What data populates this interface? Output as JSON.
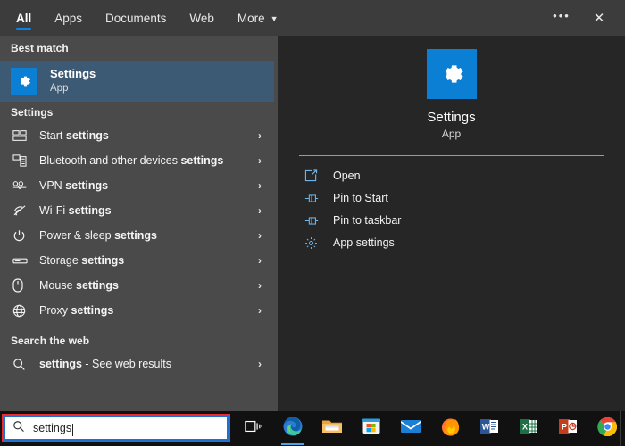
{
  "header": {
    "tabs": [
      {
        "label": "All",
        "active": true
      },
      {
        "label": "Apps",
        "active": false
      },
      {
        "label": "Documents",
        "active": false
      },
      {
        "label": "Web",
        "active": false
      },
      {
        "label": "More",
        "active": false,
        "caret": "▼"
      }
    ],
    "more_options_label": "•••",
    "close_label": "✕"
  },
  "left": {
    "best_match_header": "Best match",
    "best_match": {
      "title": "Settings",
      "subtitle": "App",
      "icon": "gear-icon"
    },
    "settings_header": "Settings",
    "settings_items": [
      {
        "prefix": "Start ",
        "bold": "settings",
        "icon": "start-grid-icon"
      },
      {
        "prefix": "Bluetooth and other devices ",
        "bold": "settings",
        "icon": "bluetooth-devices-icon"
      },
      {
        "prefix": "VPN ",
        "bold": "settings",
        "icon": "vpn-icon"
      },
      {
        "prefix": "Wi-Fi ",
        "bold": "settings",
        "icon": "wifi-icon"
      },
      {
        "prefix": "Power & sleep ",
        "bold": "settings",
        "icon": "power-icon"
      },
      {
        "prefix": "Storage ",
        "bold": "settings",
        "icon": "storage-icon"
      },
      {
        "prefix": "Mouse ",
        "bold": "settings",
        "icon": "mouse-icon"
      },
      {
        "prefix": "Proxy ",
        "bold": "settings",
        "icon": "globe-icon"
      }
    ],
    "web_header": "Search the web",
    "web_item": {
      "query": "settings",
      "suffix": " - See web results",
      "icon": "search-icon"
    },
    "chevron": "›"
  },
  "right": {
    "app_name": "Settings",
    "app_type": "App",
    "actions": [
      {
        "label": "Open",
        "icon": "open-icon"
      },
      {
        "label": "Pin to Start",
        "icon": "pin-icon"
      },
      {
        "label": "Pin to taskbar",
        "icon": "pin-icon"
      },
      {
        "label": "App settings",
        "icon": "gear-icon"
      }
    ]
  },
  "taskbar": {
    "search_value": "settings",
    "search_icon": "search-icon",
    "buttons": [
      {
        "name": "task-view",
        "label": "Task View"
      },
      {
        "name": "edge",
        "label": "Microsoft Edge",
        "active": true
      },
      {
        "name": "file-explorer",
        "label": "File Explorer"
      },
      {
        "name": "microsoft-store",
        "label": "Microsoft Store"
      },
      {
        "name": "mail",
        "label": "Mail"
      },
      {
        "name": "firefox",
        "label": "Mozilla Firefox"
      },
      {
        "name": "word",
        "label": "Word"
      },
      {
        "name": "excel",
        "label": "Excel"
      },
      {
        "name": "powerpoint",
        "label": "PowerPoint"
      },
      {
        "name": "chrome",
        "label": "Google Chrome"
      }
    ]
  },
  "colors": {
    "accent_blue": "#0a7fd4",
    "tab_underline": "#0a84e0",
    "highlight_row": "#3c5a74",
    "annotation_red": "#ef2b2b",
    "focus_blue": "#1f6fd0"
  }
}
